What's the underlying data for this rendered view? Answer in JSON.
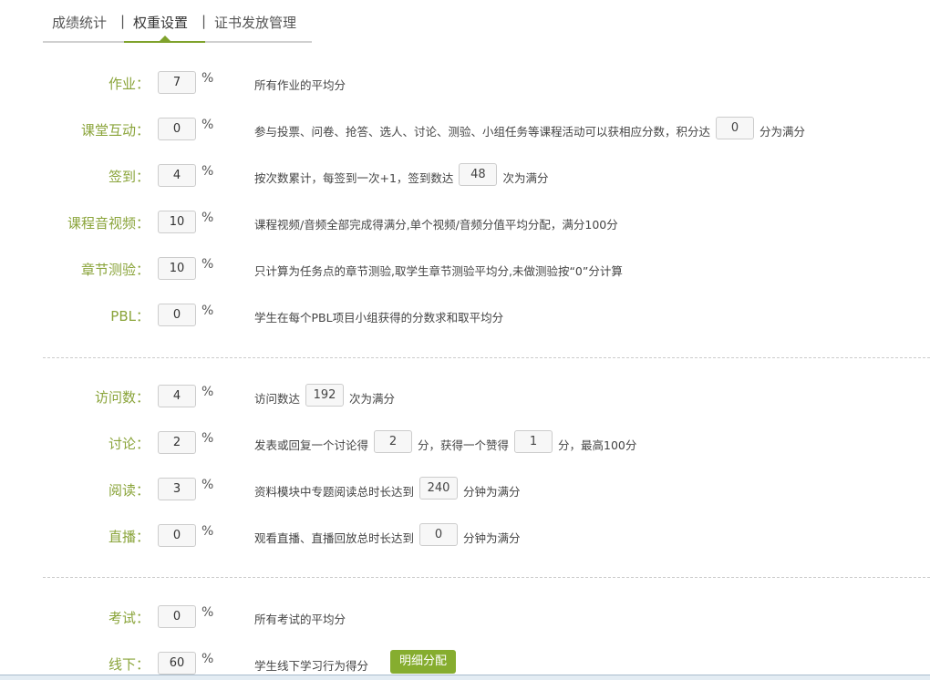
{
  "tabs": [
    "成绩统计",
    "权重设置",
    "证书发放管理"
  ],
  "tab_sep": "|",
  "percent": "%",
  "rows": [
    {
      "label": "作业：",
      "value": "7",
      "desc": "所有作业的平均分"
    },
    {
      "label": "课堂互动：",
      "value": "0",
      "desc": "参与投票、问卷、抢答、选人、讨论、测验、小组任务等课程活动可以获相应分数，积分达",
      "sub_value": "0",
      "desc_after": "分为满分"
    },
    {
      "label": "签到：",
      "value": "4",
      "desc": "按次数累计，每签到一次+1，签到数达",
      "sub_value": "48",
      "desc_after": "次为满分"
    },
    {
      "label": "课程音视频：",
      "value": "10",
      "desc": "课程视频/音频全部完成得满分,单个视频/音频分值平均分配，满分100分"
    },
    {
      "label": "章节测验：",
      "value": "10",
      "desc": "只计算为任务点的章节测验,取学生章节测验平均分,未做测验按“0”分计算"
    },
    {
      "label": "PBL：",
      "value": "0",
      "desc": "学生在每个PBL项目小组获得的分数求和取平均分"
    },
    {
      "label": "访问数：",
      "value": "4",
      "desc": "访问数达",
      "sub_value": "192",
      "desc_after": "次为满分"
    },
    {
      "label": "讨论：",
      "value": "2",
      "desc": "发表或回复一个讨论得",
      "sub_value": "2",
      "desc_mid": "分，获得一个赞得",
      "sub_value2": "1",
      "desc_after": "分，最高100分"
    },
    {
      "label": "阅读：",
      "value": "3",
      "desc": "资料模块中专题阅读总时长达到",
      "sub_value": "240",
      "desc_after": "分钟为满分"
    },
    {
      "label": "直播：",
      "value": "0",
      "desc": "观看直播、直播回放总时长达到",
      "sub_value": "0",
      "desc_after": "分钟为满分"
    },
    {
      "label": "考试：",
      "value": "0",
      "desc": "所有考试的平均分"
    },
    {
      "label": "线下：",
      "value": "60",
      "desc": "学生线下学习行为得分",
      "button": "明细分配"
    }
  ]
}
